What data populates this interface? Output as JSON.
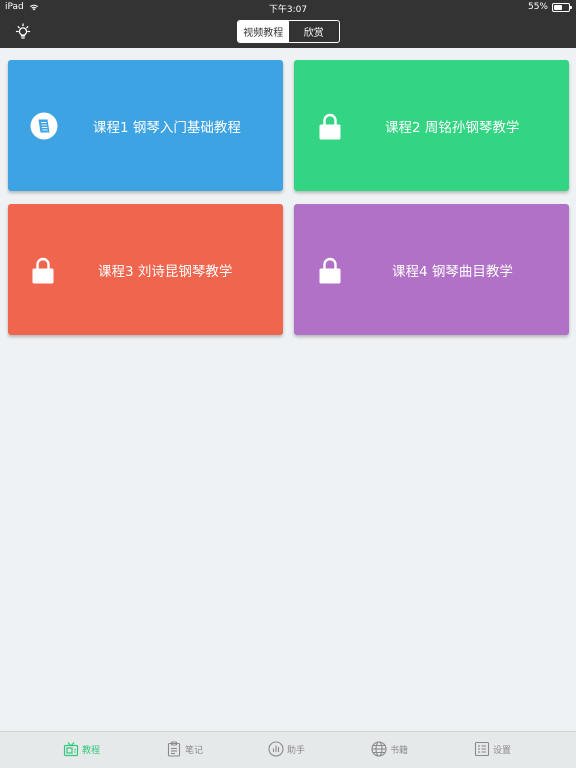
{
  "status_bar": {
    "device": "iPad",
    "time": "下午3:07",
    "battery_text": "55%",
    "battery_level": 0.55
  },
  "nav": {
    "segments": [
      {
        "label": "视频教程",
        "active": true
      },
      {
        "label": "欣赏",
        "active": false
      }
    ],
    "left_icon": "lightbulb-icon"
  },
  "courses": [
    {
      "label": "课程1 钢琴入门基础教程",
      "icon": "book-icon",
      "color": "#3ea3e3",
      "locked": false
    },
    {
      "label": "课程2 周铭孙钢琴教学",
      "icon": "lock-icon",
      "color": "#33d482",
      "locked": true
    },
    {
      "label": "课程3 刘诗昆钢琴教学",
      "icon": "lock-icon",
      "color": "#f0654e",
      "locked": true
    },
    {
      "label": "课程4 钢琴曲目教学",
      "icon": "lock-icon",
      "color": "#b071c6",
      "locked": true
    }
  ],
  "tabs": [
    {
      "label": "教程",
      "icon": "tv-icon",
      "active": true
    },
    {
      "label": "笔记",
      "icon": "clipboard-icon",
      "active": false
    },
    {
      "label": "助手",
      "icon": "chart-icon",
      "active": false
    },
    {
      "label": "书籍",
      "icon": "globe-icon",
      "active": false
    },
    {
      "label": "设置",
      "icon": "settings-list-icon",
      "active": false
    }
  ],
  "colors": {
    "bar_dark": "#333333",
    "background": "#eff2f4",
    "tab_active": "#32c97c",
    "tab_inactive": "#8a8a8a"
  }
}
